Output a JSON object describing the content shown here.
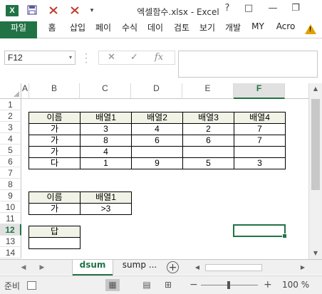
{
  "titlebar": {
    "app_icon": "X",
    "quick_access_icons": [
      "save-icon",
      "undo-icon",
      "redo-icon",
      "customize-icon"
    ],
    "title": "엑셀함수.xlsx - Excel",
    "help": "?",
    "ribbon_display": "□",
    "minimize": "—",
    "restore": "❐"
  },
  "ribbon": {
    "tabs": [
      "파일",
      "홈",
      "삽입",
      "페이",
      "수식",
      "데이",
      "검토",
      "보기",
      "개발",
      "MY",
      "Acro"
    ],
    "warning": "!"
  },
  "formula_bar": {
    "name_box": "F12",
    "name_box_arrow": "▾",
    "cancel": "✕",
    "enter": "✓",
    "fx": "fx",
    "formula": ""
  },
  "grid": {
    "columns": [
      "A",
      "B",
      "C",
      "D",
      "E",
      "F"
    ],
    "selected_column": "F",
    "rows": [
      "1",
      "2",
      "3",
      "4",
      "5",
      "6",
      "7",
      "8",
      "9",
      "10",
      "11",
      "12",
      "13",
      "14"
    ],
    "selected_row": "12",
    "main_table": {
      "headers": [
        "이름",
        "배열1",
        "배열2",
        "배열3",
        "배열4"
      ],
      "rows": [
        [
          "가",
          "3",
          "4",
          "2",
          "7"
        ],
        [
          "가",
          "8",
          "6",
          "6",
          "7"
        ],
        [
          "가",
          "4",
          "",
          "",
          ""
        ],
        [
          "다",
          "1",
          "9",
          "5",
          "3"
        ]
      ]
    },
    "criteria_table": {
      "headers": [
        "이름",
        "배열1"
      ],
      "row": [
        "가",
        ">3"
      ]
    },
    "answer_table": {
      "header": "답",
      "value": ""
    },
    "active_cell": "F12"
  },
  "sheet_tabs": {
    "tabs": [
      "dsum",
      "sump ..."
    ],
    "active": "dsum",
    "add": "+"
  },
  "status_bar": {
    "ready": "준비",
    "zoom": "100 %",
    "zoom_minus": "−",
    "zoom_plus": "+"
  },
  "colors": {
    "accent": "#217346",
    "table_header_fill": "#f0f3e6"
  }
}
